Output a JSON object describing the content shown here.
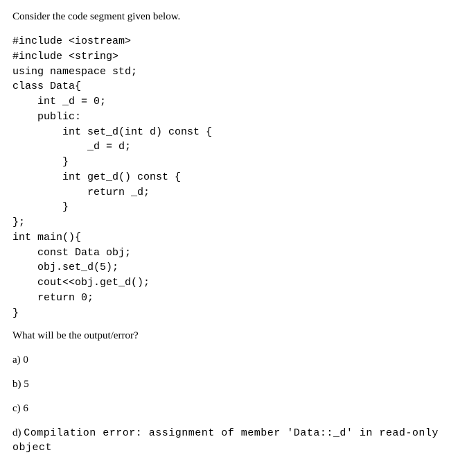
{
  "intro": "Consider the code segment given below.",
  "code": "#include <iostream>\n#include <string>\nusing namespace std;\nclass Data{\n    int _d = 0;\n    public:\n        int set_d(int d) const {\n            _d = d;\n        }\n        int get_d() const {\n            return _d;\n        }\n};\nint main(){\n    const Data obj;\n    obj.set_d(5);\n    cout<<obj.get_d();\n    return 0;\n}",
  "question": "What will be the output/error?",
  "options": {
    "a": {
      "label": "a) ",
      "value": "0"
    },
    "b": {
      "label": "b) ",
      "value": "5"
    },
    "c": {
      "label": "c) ",
      "value": "6"
    },
    "d": {
      "label": "d) ",
      "value": "Compilation error:  assignment of member 'Data::_d' in read-only object"
    }
  }
}
